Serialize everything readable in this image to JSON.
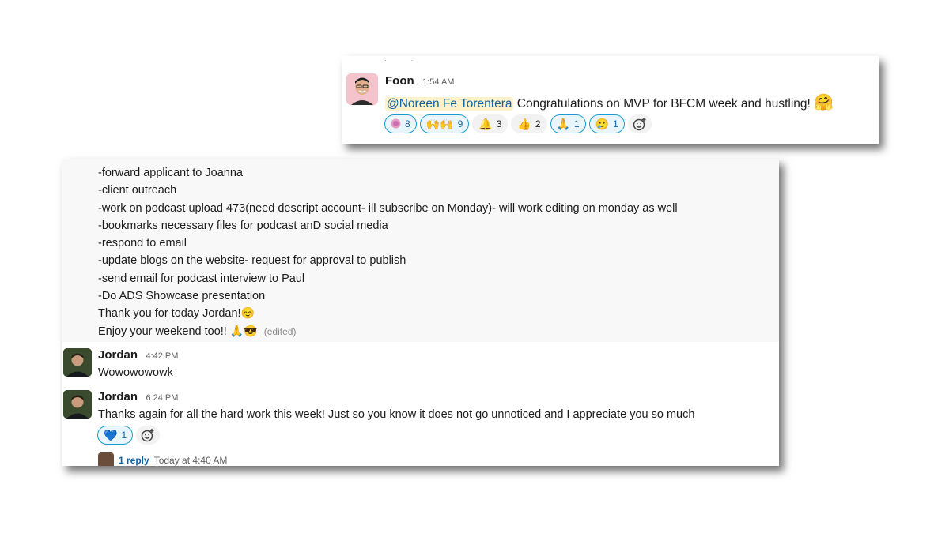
{
  "top_message": {
    "author": "Foon",
    "time": "1:54 AM",
    "mention": "@Noreen Fe Torentera",
    "text": "Congratulations on MVP for BFCM week and hustling!",
    "trailing_emoji": "🤗",
    "reactions": [
      {
        "emoji": "🟣",
        "count": "8",
        "mine": true
      },
      {
        "emoji": "🙌🙌",
        "count": "9",
        "mine": true
      },
      {
        "emoji": "🔔",
        "count": "3",
        "mine": false
      },
      {
        "emoji": "👍",
        "count": "2",
        "mine": false
      },
      {
        "emoji": "🙏",
        "count": "1",
        "mine": true
      },
      {
        "emoji": "🥲",
        "count": "1",
        "mine": true
      }
    ]
  },
  "task_list": {
    "lines": [
      "-forward applicant to Joanna",
      "-client outreach",
      "-work on podcast upload 473(need descript account- ill subscribe on Monday)- will work editing on monday as well",
      "-bookmarks necessary files for podcast anD social media",
      "-respond to email",
      "-update blogs on the website- request for approval to publish",
      "-send email for podcast interview to Paul",
      "-Do ADS Showcase presentation"
    ],
    "thanks_line": "Thank you for today Jordan!",
    "thanks_emoji": "☺️",
    "weekend_line": "Enjoy your weekend too!!",
    "weekend_emoji": "🙏😎",
    "edited_label": "(edited)"
  },
  "jordan_msg_1": {
    "author": "Jordan",
    "time": "4:42 PM",
    "text": "Wowowowowk"
  },
  "jordan_msg_2": {
    "author": "Jordan",
    "time": "6:24 PM",
    "text": "Thanks again for all the hard work this week! Just so you know it does not go unnoticed and I appreciate you so much",
    "reaction": {
      "emoji": "💙",
      "count": "1"
    }
  },
  "thread": {
    "reply_label": "1 reply",
    "reply_time": "Today at 4:40 AM"
  },
  "colors": {
    "link": "#1264a3",
    "mention_bg": "#fdf1c9",
    "reaction_mine_border": "#1d9bd1"
  }
}
